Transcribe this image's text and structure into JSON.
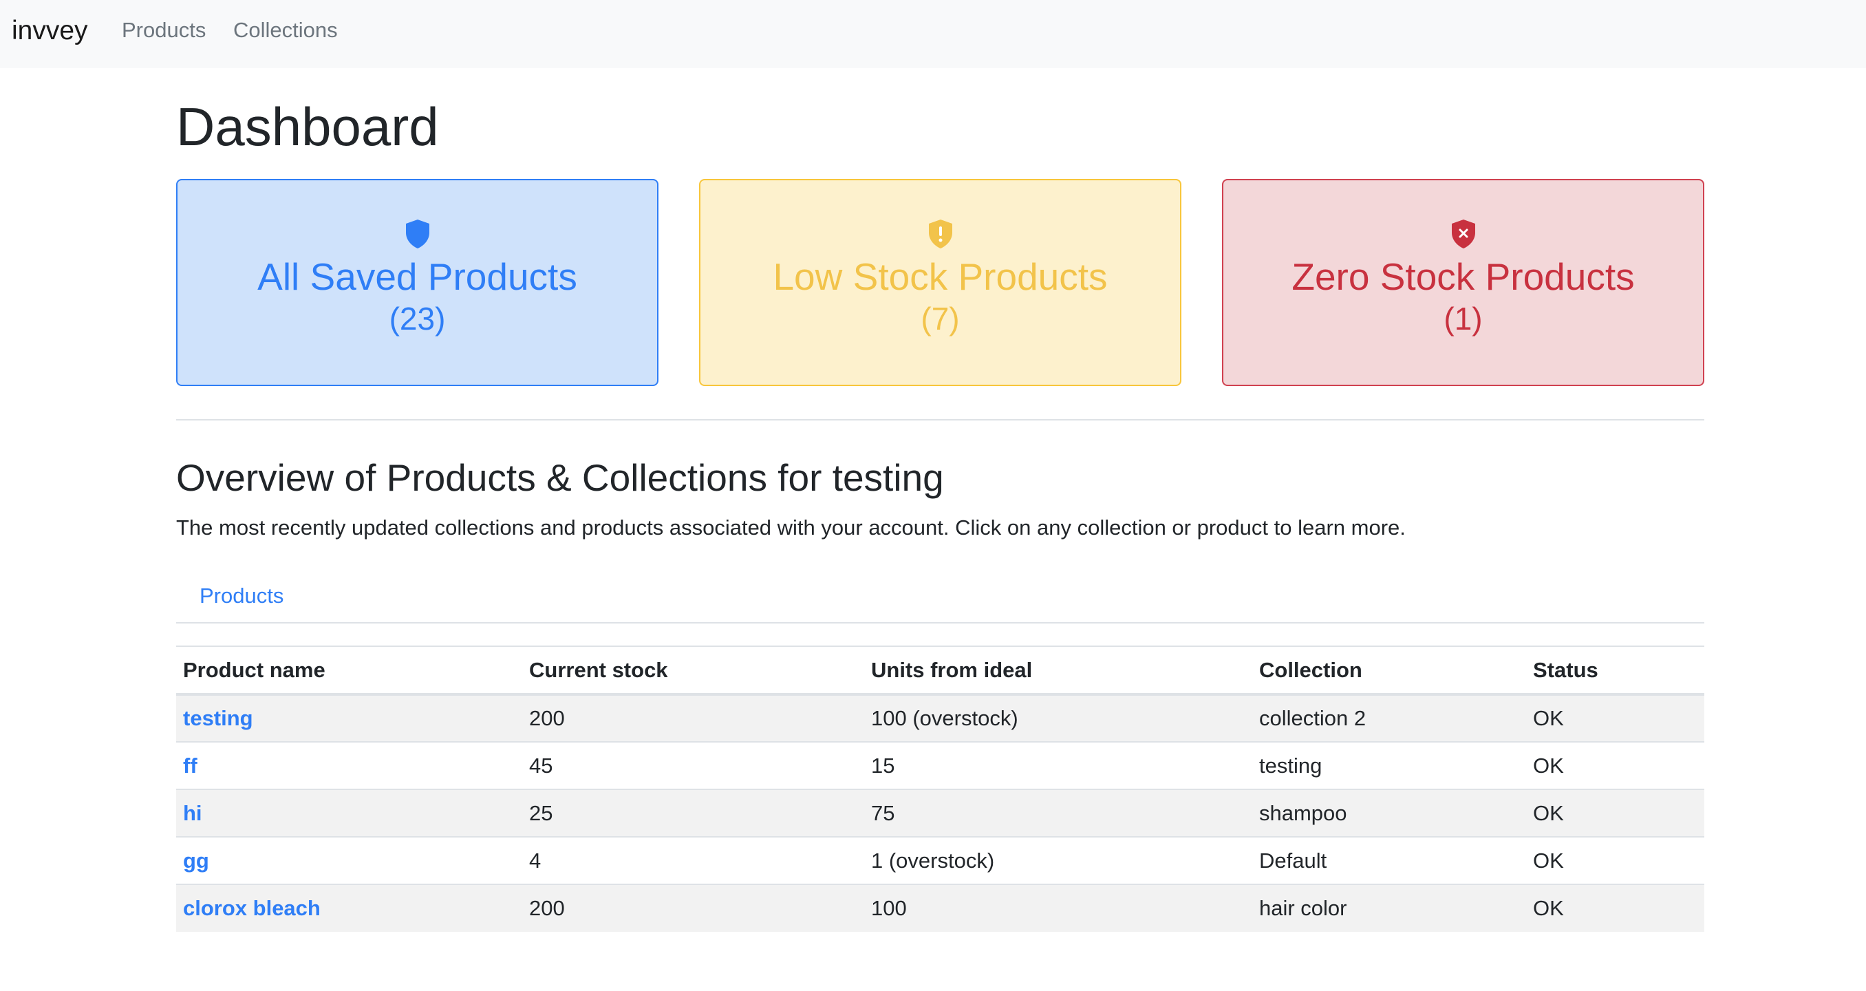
{
  "nav": {
    "brand": "invvey",
    "links": [
      "Products",
      "Collections"
    ]
  },
  "page": {
    "title": "Dashboard"
  },
  "cards": [
    {
      "title": "All Saved Products",
      "count": "(23)",
      "icon": "shield-icon",
      "color": "#2f7ef6"
    },
    {
      "title": "Low Stock Products",
      "count": "(7)",
      "icon": "shield-exclamation-icon",
      "color": "#f2c34a"
    },
    {
      "title": "Zero Stock Products",
      "count": "(1)",
      "icon": "shield-x-icon",
      "color": "#c8313f"
    }
  ],
  "overview": {
    "title": "Overview of Products & Collections for testing",
    "description": "The most recently updated collections and products associated with your account. Click on any collection or product to learn more.",
    "tab_label": "Products"
  },
  "table": {
    "headers": [
      "Product name",
      "Current stock",
      "Units from ideal",
      "Collection",
      "Status"
    ],
    "rows": [
      [
        "testing",
        "200",
        "100 (overstock)",
        "collection 2",
        "OK"
      ],
      [
        "ff",
        "45",
        "15",
        "testing",
        "OK"
      ],
      [
        "hi",
        "25",
        "75",
        "shampoo",
        "OK"
      ],
      [
        "gg",
        "4",
        "1 (overstock)",
        "Default",
        "OK"
      ],
      [
        "clorox bleach",
        "200",
        "100",
        "hair color",
        "OK"
      ]
    ]
  }
}
